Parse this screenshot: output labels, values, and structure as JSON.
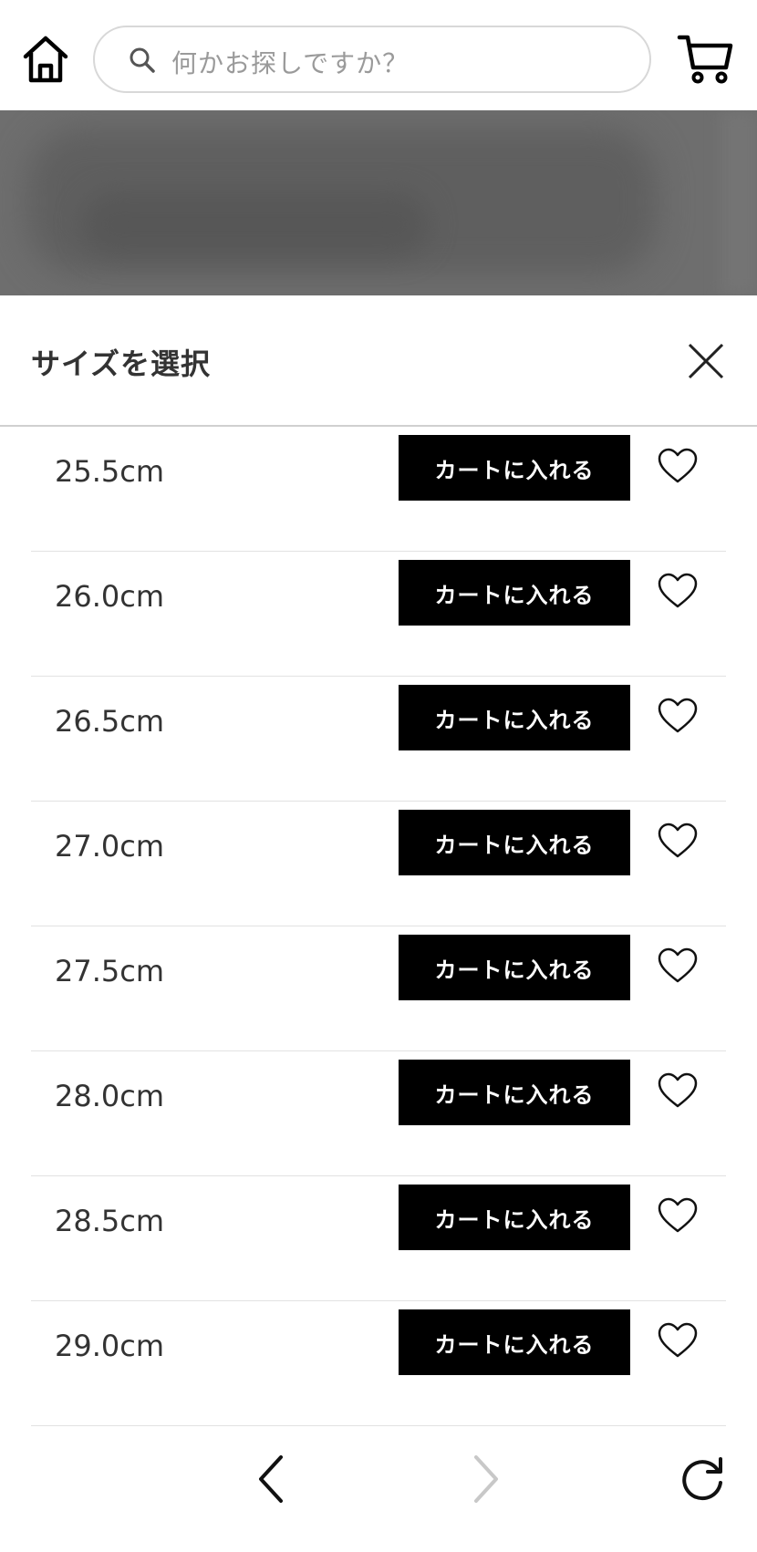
{
  "header": {
    "search_placeholder": "何かお探しですか？",
    "home_icon": "home-icon",
    "cart_icon": "cart-icon"
  },
  "sheet": {
    "title": "サイズを選択",
    "close_icon": "close-icon",
    "add_to_cart_label": "カートに入れる",
    "sizes": [
      {
        "label": "25.5cm",
        "cart_label": "カートに入れる"
      },
      {
        "label": "26.0cm",
        "cart_label": "カートに入れる"
      },
      {
        "label": "26.5cm",
        "cart_label": "カートに入れる"
      },
      {
        "label": "27.0cm",
        "cart_label": "カートに入れる"
      },
      {
        "label": "27.5cm",
        "cart_label": "カートに入れる"
      },
      {
        "label": "28.0cm",
        "cart_label": "カートに入れる"
      },
      {
        "label": "28.5cm",
        "cart_label": "カートに入れる"
      },
      {
        "label": "29.0cm",
        "cart_label": "カートに入れる"
      }
    ]
  },
  "colors": {
    "button_bg": "#000000",
    "button_text": "#ffffff",
    "banner_bg": "#6e6e6e",
    "disabled_icon": "#c8c8c8"
  },
  "bottom_nav": {
    "back_icon": "chevron-left-icon",
    "forward_icon": "chevron-right-icon",
    "reload_icon": "reload-icon"
  }
}
